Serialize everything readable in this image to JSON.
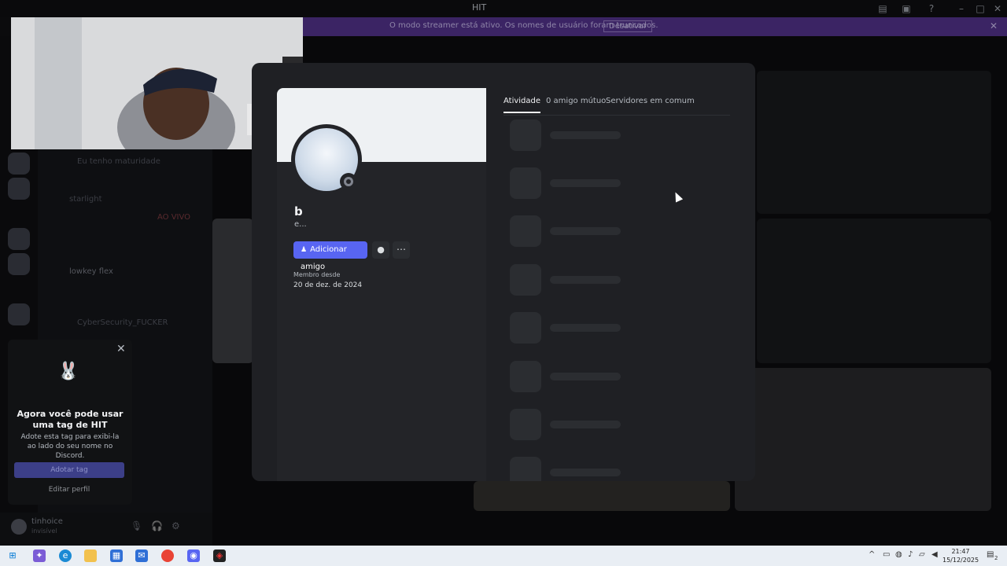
{
  "window": {
    "title": "HIT"
  },
  "streamer_banner": {
    "message": "O modo streamer está ativo. Os nomes de usuário foram truncados.",
    "button_label": "Desativar",
    "close_icon": "close-icon"
  },
  "channels": {
    "items": [
      {
        "label": "Eu tenho maturidade"
      },
      {
        "label": "starlight",
        "badge": "AO VIVO"
      },
      {
        "label": "lowkey flex"
      },
      {
        "label": "CyberSecurity_FUCKER"
      }
    ]
  },
  "profile": {
    "username": "b",
    "pronouns": "e...",
    "add_friend_label": "Adicionar amigo",
    "member_since_label": "Membro desde",
    "member_since_date": "20 de dez. de 2024",
    "tabs": [
      {
        "label": "Atividade",
        "active": true
      },
      {
        "label": "0 amigo mútuo",
        "active": false
      },
      {
        "label": "Servidores em comum",
        "active": false
      }
    ]
  },
  "tag_popup": {
    "heading": "Agora você pode usar uma tag de HIT",
    "description": "Adote esta tag para exibi-la ao lado do seu nome no Discord.",
    "adopt_label": "Adotar tag",
    "edit_label": "Editar perfil"
  },
  "user_panel": {
    "name": "tinhoice",
    "status": "invisível"
  },
  "taskbar": {
    "time": "21:47",
    "date": "15/12/2025",
    "notifications": "2"
  },
  "colors": {
    "accent": "#5865f2",
    "banner": "#3b2464",
    "modal_bg": "#1f2024"
  }
}
